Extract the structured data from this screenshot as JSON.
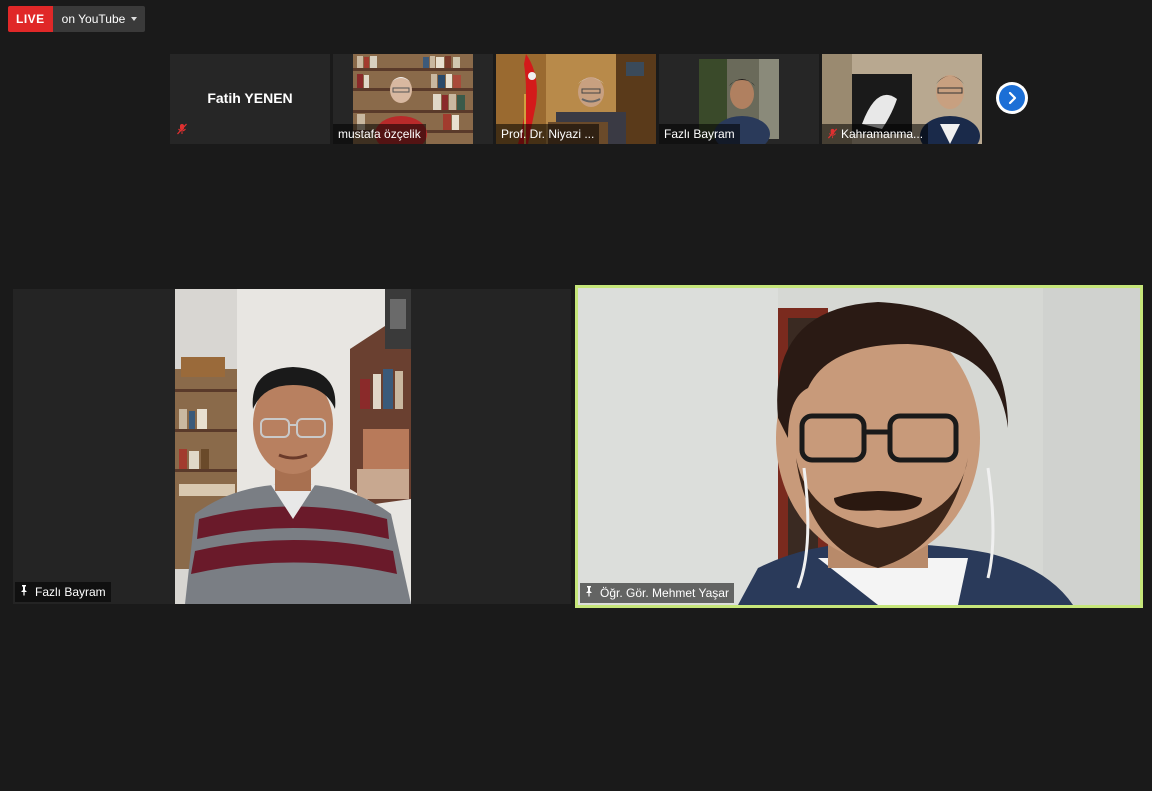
{
  "live": {
    "badge": "LIVE",
    "platform": "on YouTube"
  },
  "thumbnails": [
    {
      "name": "Fatih YENEN",
      "muted": true,
      "video": false
    },
    {
      "name": "mustafa özçelik",
      "muted": false,
      "video": true
    },
    {
      "name": "Prof. Dr. Niyazi ...",
      "muted": false,
      "video": true
    },
    {
      "name": "Fazlı Bayram",
      "muted": false,
      "video": true
    },
    {
      "name": "Kahramanma...",
      "muted": true,
      "video": true
    }
  ],
  "main": {
    "left": {
      "name": "Fazlı Bayram",
      "pinned": true
    },
    "right": {
      "name": "Öğr. Gör. Mehmet Yaşar",
      "pinned": true,
      "active_speaker": true
    }
  },
  "colors": {
    "live_red": "#e02828",
    "active_border": "#c6e67a",
    "next_blue": "#1c6fd6",
    "mute_red": "#e03030"
  },
  "icons": [
    "muted-mic-icon",
    "pin-icon",
    "chevron-right-icon",
    "dropdown-caret-icon"
  ]
}
